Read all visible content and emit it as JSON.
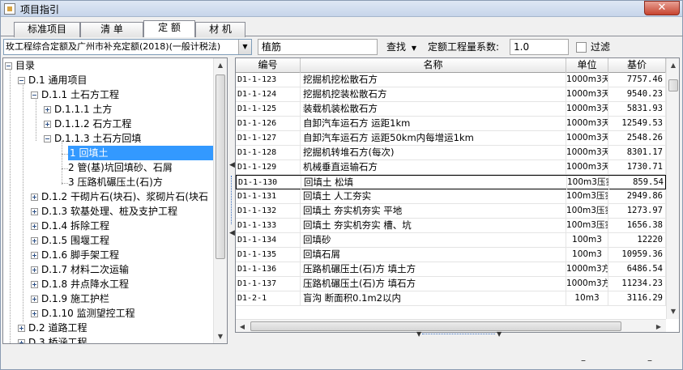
{
  "window": {
    "title": "项目指引",
    "close_label": "✕"
  },
  "tabs": [
    {
      "label": "标准项目"
    },
    {
      "label": "清 单"
    },
    {
      "label": "定 额"
    },
    {
      "label": "材 机"
    }
  ],
  "toolbar": {
    "quota_library": "玫工程综合定额及广州市补充定额(2018)(一般计税法)",
    "search_value": "植筋",
    "find_label": "查找",
    "coef_label": "定额工程量系数:",
    "coef_value": "1.0",
    "filter_label": "过滤"
  },
  "tree": [
    {
      "label": "目录"
    },
    {
      "label": "D.1 通用项目"
    },
    {
      "label": "D.1.1 土石方工程"
    },
    {
      "label": "D.1.1.1 土方"
    },
    {
      "label": "D.1.1.2 石方工程"
    },
    {
      "label": "D.1.1.3 土石方回填"
    },
    {
      "label": "1 回填土"
    },
    {
      "label": "2 管(基)坑回填砂、石屑"
    },
    {
      "label": "3 压路机碾压土(石)方"
    },
    {
      "label": "D.1.2 干砌片石(块石)、浆砌片石(块石"
    },
    {
      "label": "D.1.3 软基处理、桩及支护工程"
    },
    {
      "label": "D.1.4 拆除工程"
    },
    {
      "label": "D.1.5 围堰工程"
    },
    {
      "label": "D.1.6 脚手架工程"
    },
    {
      "label": "D.1.7 材料二次运输"
    },
    {
      "label": "D.1.8 井点降水工程"
    },
    {
      "label": "D.1.9 施工护栏"
    },
    {
      "label": "D.1.10 监测望控工程"
    },
    {
      "label": "D.2 道路工程"
    },
    {
      "label": "D.3 桥涵工程"
    }
  ],
  "grid": {
    "headers": {
      "code": "编号",
      "name": "名称",
      "unit": "单位",
      "price": "基价"
    },
    "rows": [
      {
        "code": "D1-1-123",
        "name": "挖掘机挖松散石方",
        "unit": "1000m3天",
        "price": "7757.46"
      },
      {
        "code": "D1-1-124",
        "name": "挖掘机挖装松散石方",
        "unit": "1000m3天",
        "price": "9540.23"
      },
      {
        "code": "D1-1-125",
        "name": "装载机装松散石方",
        "unit": "1000m3天",
        "price": "5831.93"
      },
      {
        "code": "D1-1-126",
        "name": "自卸汽车运石方 运距1km",
        "unit": "1000m3天",
        "price": "12549.53"
      },
      {
        "code": "D1-1-127",
        "name": "自卸汽车运石方 运距50km内每增运1km",
        "unit": "1000m3天",
        "price": "2548.26"
      },
      {
        "code": "D1-1-128",
        "name": "挖掘机转堆石方(每次)",
        "unit": "1000m3天然",
        "price": "8301.17"
      },
      {
        "code": "D1-1-129",
        "name": "机械垂直运输石方",
        "unit": "1000m3天",
        "price": "1730.71"
      },
      {
        "code": "D1-1-130",
        "name": "回填土 松填",
        "unit": "100m3压实",
        "price": "859.54"
      },
      {
        "code": "D1-1-131",
        "name": "回填土 人工夯实",
        "unit": "100m3压实",
        "price": "2949.86"
      },
      {
        "code": "D1-1-132",
        "name": "回填土 夯实机夯实 平地",
        "unit": "100m3压实",
        "price": "1273.97"
      },
      {
        "code": "D1-1-133",
        "name": "回填土 夯实机夯实 槽、坑",
        "unit": "100m3压实",
        "price": "1656.38"
      },
      {
        "code": "D1-1-134",
        "name": "回填砂",
        "unit": "100m3",
        "price": "12220"
      },
      {
        "code": "D1-1-135",
        "name": "回填石屑",
        "unit": "100m3",
        "price": "10959.36"
      },
      {
        "code": "D1-1-136",
        "name": "压路机碾压土(石)方 填土方",
        "unit": "1000m3方",
        "price": "6486.54"
      },
      {
        "code": "D1-1-137",
        "name": "压路机碾压土(石)方 填石方",
        "unit": "1000m3方",
        "price": "11234.23"
      },
      {
        "code": "D1-2-1",
        "name": "盲沟 断面积0.1m2以内",
        "unit": "10m3",
        "price": "3116.29"
      }
    ]
  },
  "icons": {
    "dropdown_arrow": "▼",
    "splitter_left": "◀",
    "scroll_up": "▲",
    "scroll_down": "▼",
    "scroll_left": "◀",
    "scroll_right": "▶"
  },
  "footer": {
    "dash_left": "–",
    "dash_right": "–"
  }
}
